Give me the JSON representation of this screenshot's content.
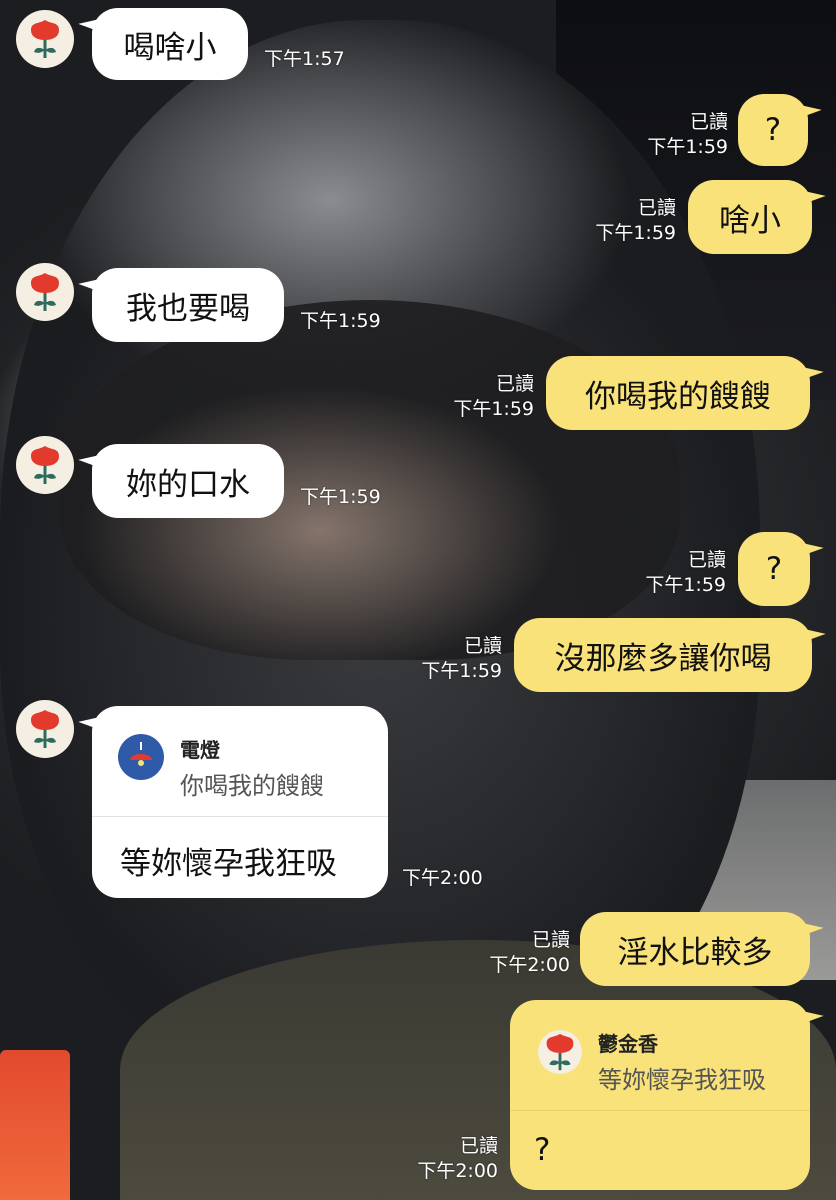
{
  "colors": {
    "sent_bubble": "#f9e27a",
    "received_bubble": "#ffffff",
    "avatar_bg": "#f5efe3",
    "flower_red": "#e23b2e",
    "flower_stem": "#2e6b5e",
    "lamp_icon_bg": "#2f5aa8"
  },
  "avatar_icon": "red-flower-icon",
  "messages": [
    {
      "side": "received",
      "text": "喝啥小",
      "time": "下午1:57"
    },
    {
      "side": "sent",
      "text": "?",
      "read": "已讀",
      "time": "下午1:59"
    },
    {
      "side": "sent",
      "text": "啥小",
      "read": "已讀",
      "time": "下午1:59"
    },
    {
      "side": "received",
      "text": "我也要喝",
      "time": "下午1:59"
    },
    {
      "side": "sent",
      "text": "你喝我的餿餿",
      "read": "已讀",
      "time": "下午1:59"
    },
    {
      "side": "received",
      "text": "妳的口水",
      "time": "下午1:59"
    },
    {
      "side": "sent",
      "text": "?",
      "read": "已讀",
      "time": "下午1:59"
    },
    {
      "side": "sent",
      "text": "沒那麼多讓你喝",
      "read": "已讀",
      "time": "下午1:59"
    },
    {
      "side": "received",
      "reply_name": "電燈",
      "reply_text": "你喝我的餿餿",
      "reply_icon": "lamp-icon",
      "text": "等妳懷孕我狂吸",
      "time": "下午2:00"
    },
    {
      "side": "sent",
      "text": "淫水比較多",
      "read": "已讀",
      "time": "下午2:00"
    },
    {
      "side": "sent",
      "reply_name": "鬱金香",
      "reply_text": "等妳懷孕我狂吸",
      "reply_icon": "red-flower-icon",
      "text": "?",
      "read": "已讀",
      "time": "下午2:00"
    }
  ]
}
